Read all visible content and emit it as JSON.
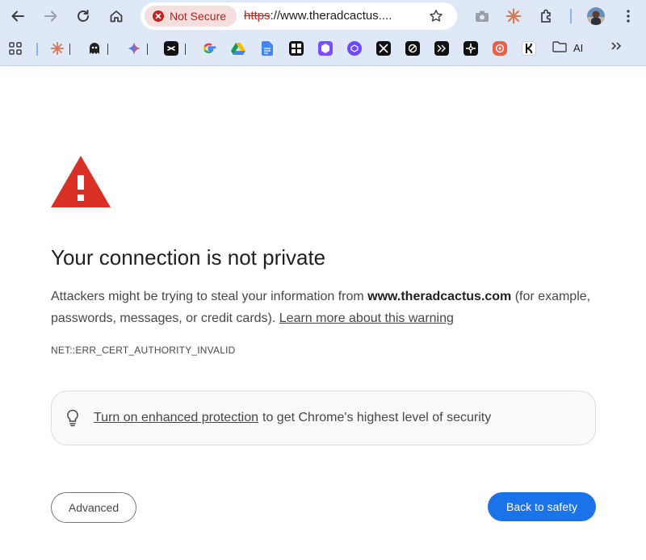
{
  "browser": {
    "security_chip": "Not Secure",
    "url_scheme": "https",
    "url_rest": "://www.theradcactus....",
    "bookmark_folder": "AI",
    "colors": {
      "toolbar": "#dfe8f7",
      "danger": "#c5221f",
      "primary": "#1a73e8"
    }
  },
  "bookmarks": [
    {
      "icon": "apps-grid-icon"
    },
    {
      "icon": "claude-icon"
    },
    {
      "icon": "ghost-icon"
    },
    {
      "icon": "gemini-icon"
    },
    {
      "icon": "capcut-icon"
    },
    {
      "icon": "google-icon"
    },
    {
      "icon": "google-drive-icon"
    },
    {
      "icon": "google-docs-icon"
    },
    {
      "icon": "notion-grid-icon"
    },
    {
      "icon": "purple-app-icon"
    },
    {
      "icon": "proton-icon"
    },
    {
      "icon": "x-icon"
    },
    {
      "icon": "perplexity-icon"
    },
    {
      "icon": "terminal-icon"
    },
    {
      "icon": "compass-icon"
    },
    {
      "icon": "orange-app-icon"
    },
    {
      "icon": "klarna-icon"
    },
    {
      "icon": "folder-icon"
    }
  ],
  "page": {
    "heading": "Your connection is not private",
    "para_before": "Attackers might be trying to steal your information from ",
    "domain": "www.theradcactus.com",
    "para_after": " (for example, passwords, messages, or credit cards). ",
    "learn_more": "Learn more about this warning",
    "error_code": "NET::ERR_CERT_AUTHORITY_INVALID",
    "tip_link": "Turn on enhanced protection",
    "tip_text": "to get Chrome's highest level of security",
    "advanced_label": "Advanced",
    "back_label": "Back to safety"
  }
}
